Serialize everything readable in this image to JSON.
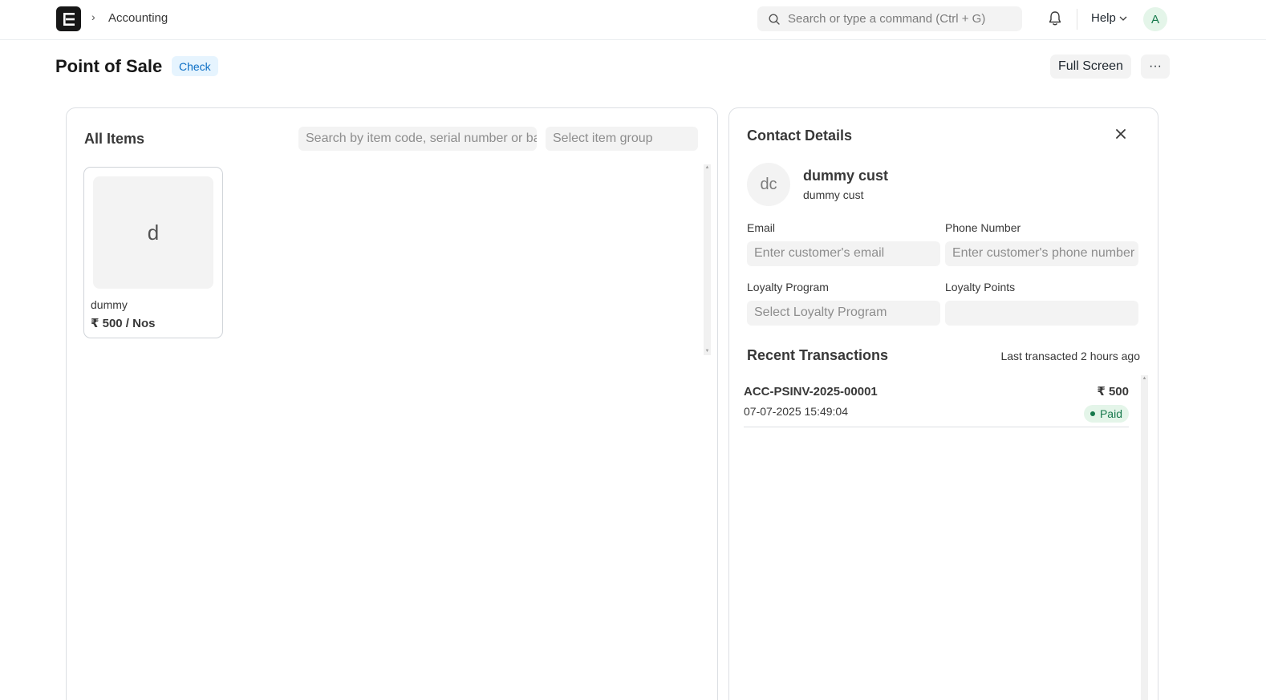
{
  "navbar": {
    "logo_letter": "E",
    "breadcrumb_separator": "›",
    "breadcrumb": "Accounting",
    "search_placeholder": "Search or type a command (Ctrl + G)",
    "help_label": "Help",
    "user_initial": "A"
  },
  "page": {
    "title": "Point of Sale",
    "status_badge": "Check",
    "full_screen_label": "Full Screen",
    "more_label": "···"
  },
  "items_panel": {
    "title": "All Items",
    "search_placeholder": "Search by item code, serial number or barcode",
    "group_placeholder": "Select item group",
    "items": [
      {
        "initial": "d",
        "name": "dummy",
        "price": "₹ 500 / Nos"
      }
    ]
  },
  "contact_panel": {
    "title": "Contact Details",
    "customer_initials": "dc",
    "customer_name": "dummy cust",
    "customer_sub": "dummy cust",
    "email_label": "Email",
    "email_placeholder": "Enter customer's email",
    "phone_label": "Phone Number",
    "phone_placeholder": "Enter customer's phone number",
    "loyalty_program_label": "Loyalty Program",
    "loyalty_program_placeholder": "Select Loyalty Program",
    "loyalty_points_label": "Loyalty Points",
    "loyalty_points_value": "",
    "recent_title": "Recent Transactions",
    "last_transacted": "Last transacted 2 hours ago",
    "transactions": [
      {
        "id": "ACC-PSINV-2025-00001",
        "date": "07-07-2025 15:49:04",
        "amount": "₹ 500",
        "status": "Paid"
      }
    ]
  },
  "colors": {
    "accent_blue": "#0b6ec5",
    "paid_green": "#16794c",
    "paid_bg": "#e4f5e9"
  }
}
